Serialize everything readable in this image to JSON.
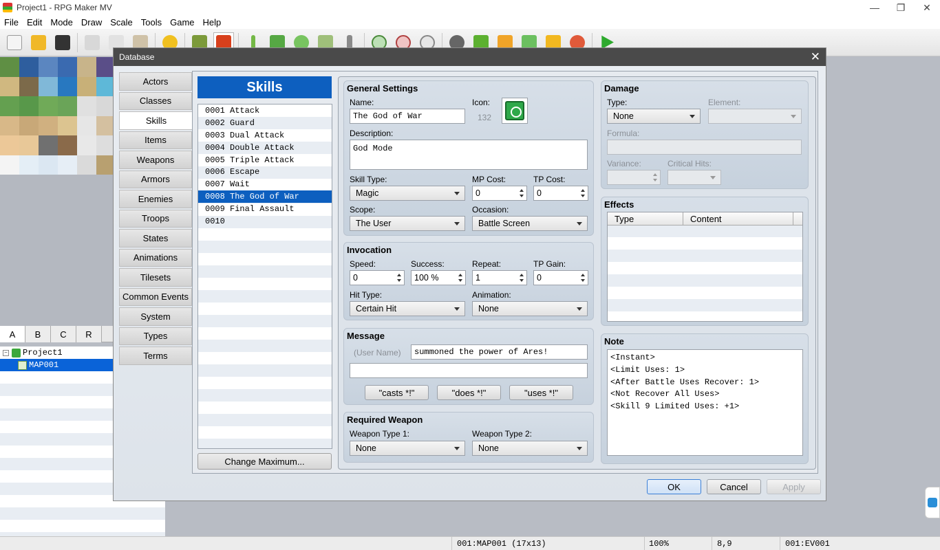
{
  "window": {
    "title": "Project1 - RPG Maker MV",
    "controls": [
      "—",
      "❐",
      "✕"
    ]
  },
  "menu": [
    "File",
    "Edit",
    "Mode",
    "Draw",
    "Scale",
    "Tools",
    "Game",
    "Help"
  ],
  "toolbar_icons": [
    "new-project-icon",
    "open-project-icon",
    "save-project-icon",
    "cut-icon",
    "copy-icon",
    "paste-icon",
    "undo-icon",
    "map-mode-icon",
    "event-mode-icon",
    "pencil-icon",
    "rectangle-icon",
    "ellipse-icon",
    "fill-icon",
    "shadow-pen-icon",
    "zoom-in-icon",
    "zoom-out-icon",
    "actual-size-icon",
    "database-icon",
    "plugin-manager-icon",
    "sound-test-icon",
    "event-searcher-icon",
    "resource-manager-icon",
    "character-generator-icon",
    "playtest-icon"
  ],
  "tileset_tabs": [
    "A",
    "B",
    "C",
    "R"
  ],
  "map_tree": {
    "project": "Project1",
    "map": "MAP001"
  },
  "status_bar": {
    "map": "001:MAP001 (17x13)",
    "zoom": "100%",
    "coords": "8,9",
    "event": "001:EV001"
  },
  "dialog": {
    "title": "Database",
    "categories": [
      "Actors",
      "Classes",
      "Skills",
      "Items",
      "Weapons",
      "Armors",
      "Enemies",
      "Troops",
      "States",
      "Animations",
      "Tilesets",
      "Common Events",
      "System",
      "Types",
      "Terms"
    ],
    "active_category": "Skills",
    "list_title": "Skills",
    "items": [
      "0001 Attack",
      "0002 Guard",
      "0003 Dual Attack",
      "0004 Double Attack",
      "0005 Triple Attack",
      "0006 Escape",
      "0007 Wait",
      "0008 The God of War",
      "0009 Final Assault",
      "0010"
    ],
    "selected_item": "0008 The God of War",
    "change_max_label": "Change Maximum...",
    "general": {
      "title": "General Settings",
      "name_label": "Name:",
      "name_value": "The God of War",
      "icon_label": "Icon:",
      "icon_index": "132",
      "description_label": "Description:",
      "description_value": "God Mode",
      "skill_type_label": "Skill Type:",
      "skill_type_value": "Magic",
      "mp_cost_label": "MP Cost:",
      "mp_cost_value": "0",
      "tp_cost_label": "TP Cost:",
      "tp_cost_value": "0",
      "scope_label": "Scope:",
      "scope_value": "The User",
      "occasion_label": "Occasion:",
      "occasion_value": "Battle Screen"
    },
    "invocation": {
      "title": "Invocation",
      "speed_label": "Speed:",
      "speed_value": "0",
      "success_label": "Success:",
      "success_value": "100 %",
      "repeat_label": "Repeat:",
      "repeat_value": "1",
      "tp_gain_label": "TP Gain:",
      "tp_gain_value": "0",
      "hit_type_label": "Hit Type:",
      "hit_type_value": "Certain Hit",
      "animation_label": "Animation:",
      "animation_value": "None"
    },
    "message": {
      "title": "Message",
      "user_name_label": "(User Name)",
      "line1": "summoned the power of Ares!",
      "line2": "",
      "casts_btn": "\"casts *!\"",
      "does_btn": "\"does *!\"",
      "uses_btn": "\"uses *!\""
    },
    "required_weapon": {
      "title": "Required Weapon",
      "type1_label": "Weapon Type 1:",
      "type1_value": "None",
      "type2_label": "Weapon Type 2:",
      "type2_value": "None"
    },
    "damage": {
      "title": "Damage",
      "type_label": "Type:",
      "type_value": "None",
      "element_label": "Element:",
      "element_value": "",
      "formula_label": "Formula:",
      "formula_value": "",
      "variance_label": "Variance:",
      "variance_value": "",
      "critical_label": "Critical Hits:",
      "critical_value": ""
    },
    "effects": {
      "title": "Effects",
      "col_type": "Type",
      "col_content": "Content"
    },
    "note": {
      "title": "Note",
      "lines": [
        "<Instant>",
        "<Limit Uses: 1>",
        "<After Battle Uses Recover: 1>",
        "<Not Recover All Uses>",
        "<Skill 9 Limited Uses: +1>"
      ]
    },
    "buttons": {
      "ok": "OK",
      "cancel": "Cancel",
      "apply": "Apply"
    }
  }
}
